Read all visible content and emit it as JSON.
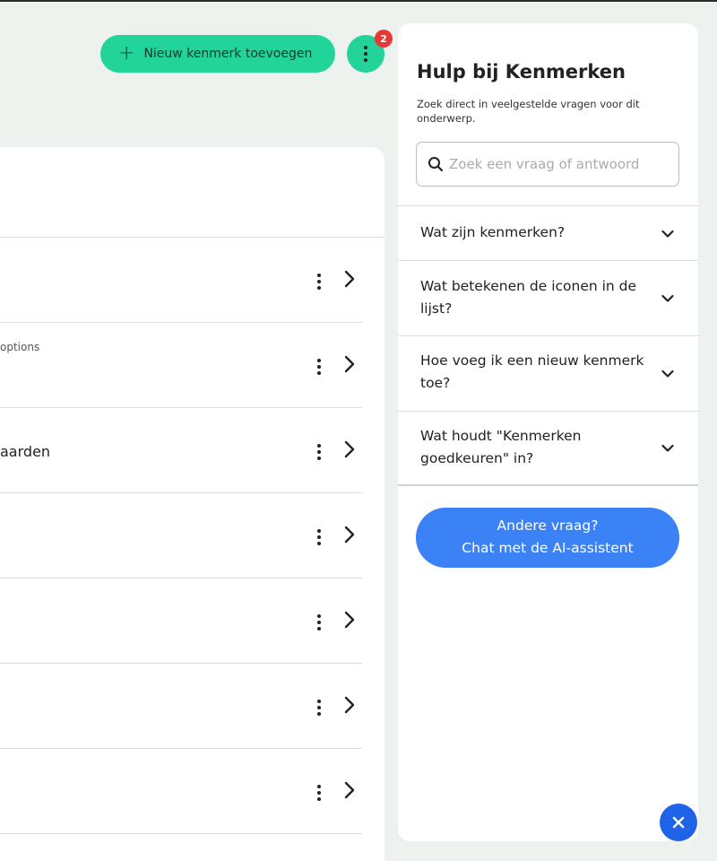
{
  "toolbar": {
    "add_button_label": "Nieuw kenmerk toevoegen",
    "notification_count": "2"
  },
  "list": {
    "rows": [
      {
        "sub": "",
        "text": ""
      },
      {
        "sub": "options",
        "text": ""
      },
      {
        "sub": "",
        "text": "aarden"
      },
      {
        "sub": "",
        "text": ""
      },
      {
        "sub": "",
        "text": ""
      },
      {
        "sub": "",
        "text": ""
      },
      {
        "sub": "",
        "text": ""
      }
    ]
  },
  "help": {
    "title": "Hulp bij Kenmerken",
    "description": "Zoek direct in veelgestelde vragen voor dit onderwerp.",
    "search_placeholder": "Zoek een vraag of antwoord",
    "faqs": [
      {
        "question": "Wat zijn kenmerken?"
      },
      {
        "question": "Wat betekenen de iconen in de lijst?"
      },
      {
        "question": "Hoe voeg ik een nieuw kenmerk toe?"
      },
      {
        "question": "Wat houdt \"Kenmerken goedkeuren\" in?"
      }
    ],
    "ai_button_line1": "Andere vraag?",
    "ai_button_line2": "Chat met de AI-assistent"
  },
  "colors": {
    "background": "#eef2ee",
    "accent_green": "#22d39a",
    "accent_blue": "#3b82f6",
    "badge_red": "#e53935",
    "fab_blue": "#1f63e8"
  },
  "icons": [
    "plus-icon",
    "kebab-icon",
    "chevron-right-icon",
    "search-icon",
    "chevron-down-icon",
    "close-icon"
  ]
}
